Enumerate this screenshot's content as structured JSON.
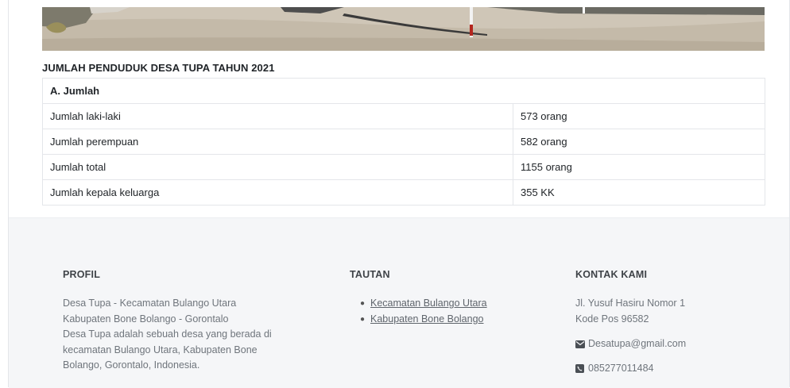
{
  "stats": {
    "title": "JUMLAH PENDUDUK DESA TUPA TAHUN 2021",
    "group_label": "A. Jumlah",
    "rows": [
      {
        "label": "Jumlah laki-laki",
        "value": "573 orang"
      },
      {
        "label": "Jumlah perempuan",
        "value": "582 orang"
      },
      {
        "label": "Jumlah total",
        "value": "1155 orang"
      },
      {
        "label": "Jumlah kepala keluarga",
        "value": "355 KK"
      }
    ]
  },
  "footer": {
    "profil": {
      "heading": "PROFIL",
      "lines": [
        "Desa Tupa - Kecamatan Bulango Utara",
        "Kabupaten Bone Bolango - Gorontalo",
        "Desa Tupa adalah sebuah desa yang berada di",
        "kecamatan Bulango Utara, Kabupaten Bone",
        "Bolango, Gorontalo, Indonesia."
      ]
    },
    "tautan": {
      "heading": "TAUTAN",
      "links": [
        "Kecamatan Bulango Utara",
        "Kabupaten Bone Bolango"
      ]
    },
    "kontak": {
      "heading": "KONTAK KAMI",
      "address_lines": [
        "Jl. Yusuf Hasiru Nomor 1",
        "Kode Pos 96582"
      ],
      "email": "Desatupa@gmail.com",
      "phone": "085277011484",
      "email_icon": "envelope-icon",
      "phone_icon": "phone-icon"
    }
  }
}
